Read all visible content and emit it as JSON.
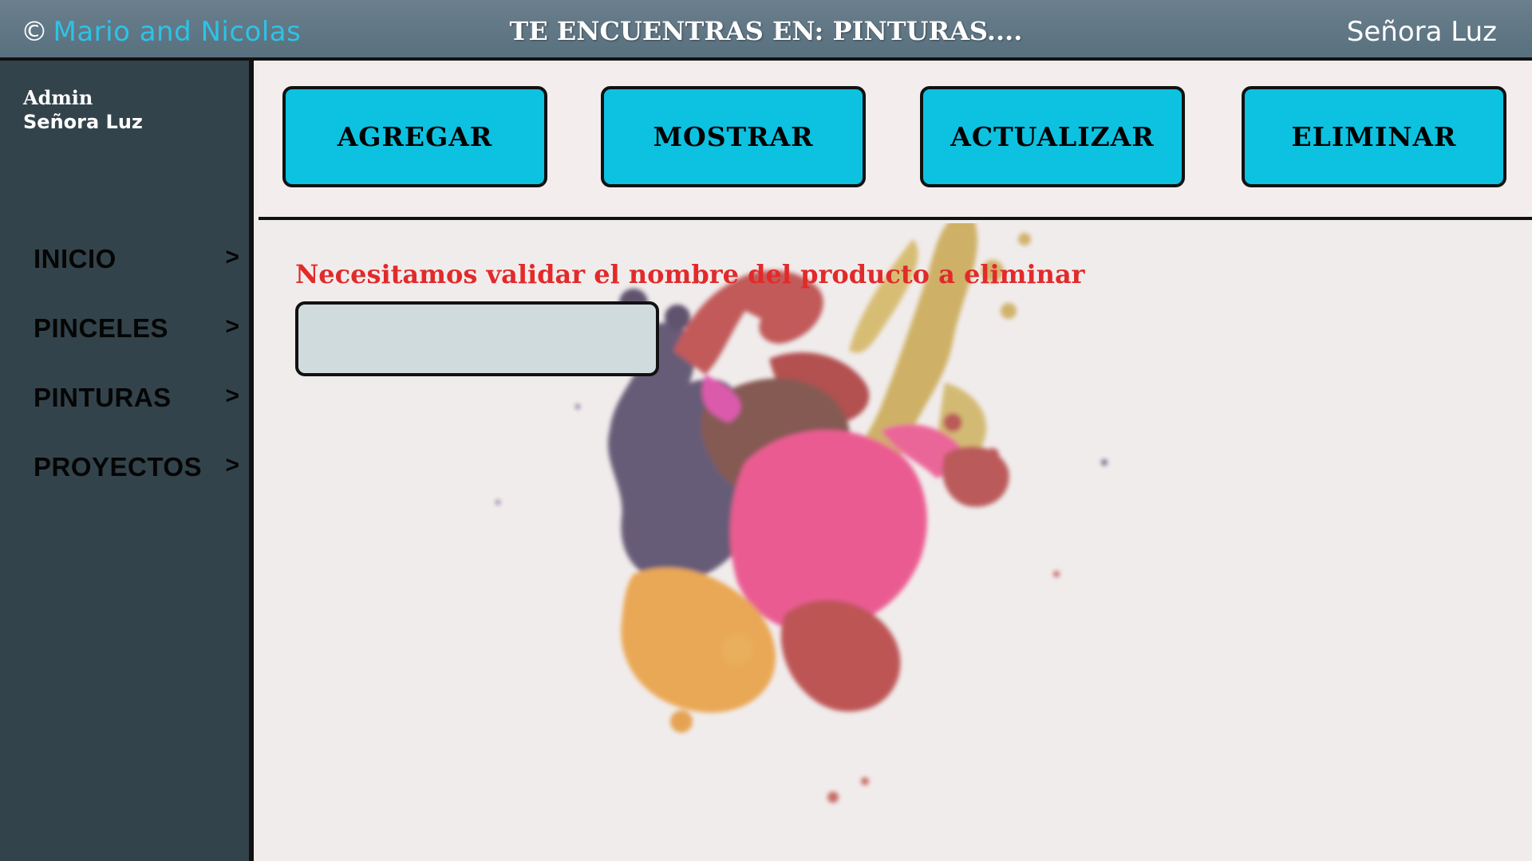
{
  "header": {
    "copyright_symbol": "©",
    "brand": "Mario and Nicolas",
    "location": "TE ENCUENTRAS EN: PINTURAS....",
    "user": "Señora Luz"
  },
  "sidebar": {
    "role": "Admin",
    "user": "Señora Luz",
    "items": [
      {
        "label": "INICIO",
        "arrow": ">"
      },
      {
        "label": "PINCELES",
        "arrow": ">"
      },
      {
        "label": "PINTURAS",
        "arrow": ">"
      },
      {
        "label": "PROYECTOS",
        "arrow": ">"
      }
    ]
  },
  "toolbar": {
    "add_label": "AGREGAR",
    "show_label": "MOSTRAR",
    "update_label": "ACTUALIZAR",
    "delete_label": "ELIMINAR"
  },
  "main": {
    "prompt": "Necesitamos validar el nombre del producto a eliminar",
    "input_value": "",
    "input_placeholder": ""
  },
  "colors": {
    "accent": "#0dc1e0",
    "brand": "#2cc3e6",
    "warning": "#e22a2a",
    "sidebar": "#33434b",
    "topbar": "#5f7684"
  }
}
